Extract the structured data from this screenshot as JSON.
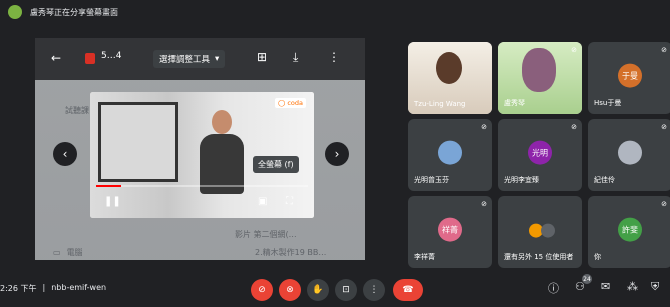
{
  "topbar": {
    "title": "盧秀琴正在分享螢幕畫面"
  },
  "share": {
    "page_counter": "5…4",
    "tool_select": "選擇調整工具",
    "tooltip": "全螢幕 (f)",
    "video_logo": "◯ coda",
    "progress": 0.12,
    "bg_rows": [
      "試聽課 ›",
      "影片 第二個網(…",
      "電腦",
      "2.精木製作19 BB…"
    ]
  },
  "participants": [
    {
      "name": "Tzu-Ling Wang",
      "type": "camera",
      "color": "#e9e2d8"
    },
    {
      "name": "盧秀琴",
      "type": "camera",
      "color": "#cfe7b8"
    },
    {
      "name": "Hsu于曼",
      "type": "avatar",
      "avatar_text": "于曼",
      "color": "#d4702a"
    },
    {
      "name": "光明曾玉芬",
      "type": "photo",
      "color": "#7aa5d6"
    },
    {
      "name": "光明李宜臻",
      "type": "avatar",
      "avatar_text": "光明",
      "color": "#8e24aa"
    },
    {
      "name": "紀佳伶",
      "type": "photo",
      "color": "#b0b6c0"
    },
    {
      "name": "李祥菁",
      "type": "avatar",
      "avatar_text": "祥菁",
      "color": "#e06a8a"
    },
    {
      "name": "還有另外 15 位使用者",
      "type": "group",
      "color": "#f29900"
    },
    {
      "name": "你",
      "type": "avatar",
      "avatar_text": "許斐",
      "color": "#43a047"
    }
  ],
  "bottom": {
    "time": "2:26 下午",
    "separator": "|",
    "meeting_code": "nbb-emif-wen",
    "people_count": "24"
  }
}
